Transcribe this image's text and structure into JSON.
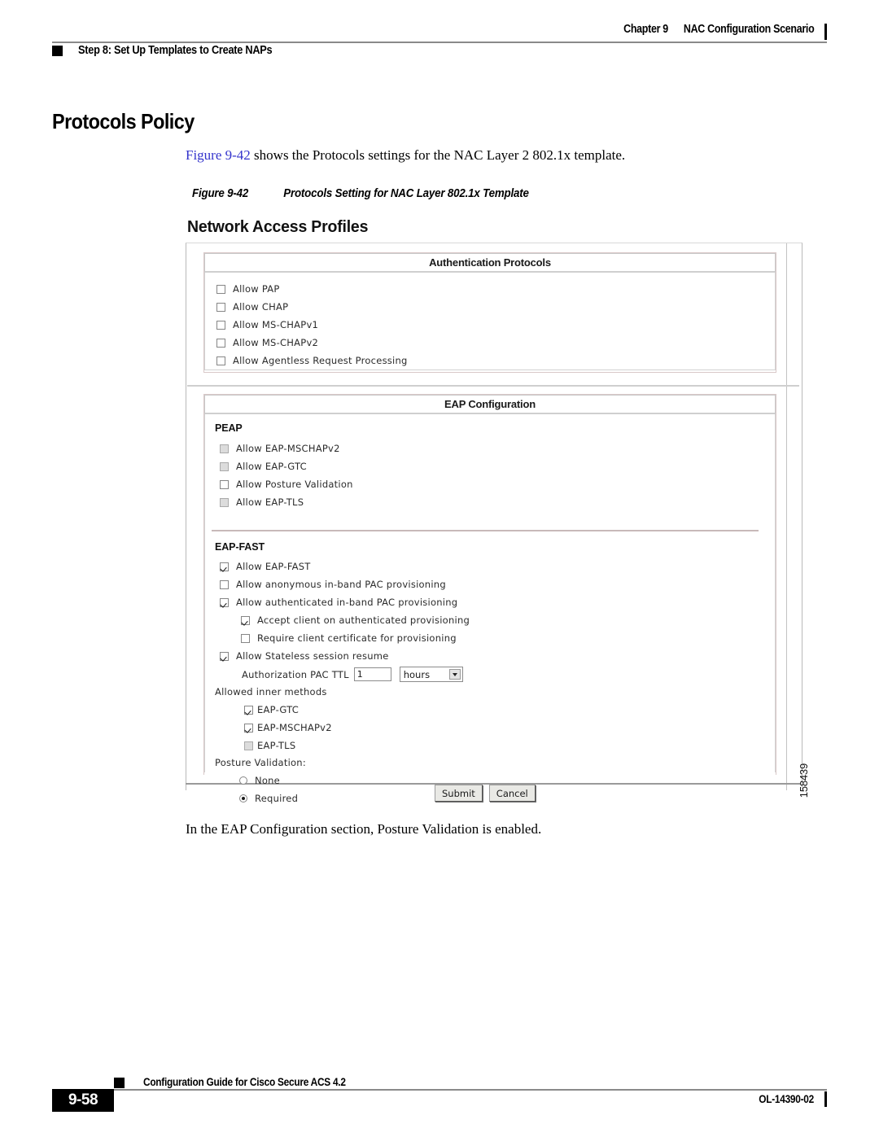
{
  "header": {
    "chapter_number": "Chapter 9",
    "chapter_title": "NAC Configuration Scenario",
    "step_title": "Step 8: Set Up Templates to Create NAPs"
  },
  "page": {
    "section_title": "Protocols Policy",
    "intro_xref": "Figure 9-42",
    "intro_rest": " shows the Protocols settings for the NAC Layer 2 802.1x template.",
    "figure_label": "Figure 9-42",
    "figure_title": "Protocols Setting for NAC Layer 802.1x Template",
    "closing_text": "In the EAP Configuration section, Posture Validation is enabled.",
    "figure_id": "158439"
  },
  "app": {
    "title": "Network Access Profiles",
    "auth_panel": {
      "heading": "Authentication Protocols",
      "items": [
        {
          "label": "Allow PAP",
          "checked": false,
          "disabled": false
        },
        {
          "label": "Allow CHAP",
          "checked": false,
          "disabled": false
        },
        {
          "label": "Allow MS-CHAPv1",
          "checked": false,
          "disabled": false
        },
        {
          "label": "Allow MS-CHAPv2",
          "checked": false,
          "disabled": false
        },
        {
          "label": "Allow Agentless Request Processing",
          "checked": false,
          "disabled": false
        }
      ]
    },
    "eap_panel": {
      "heading": "EAP Configuration",
      "peap": {
        "heading": "PEAP",
        "items": [
          {
            "label": "Allow EAP-MSCHAPv2",
            "checked": false,
            "disabled": true
          },
          {
            "label": "Allow EAP-GTC",
            "checked": false,
            "disabled": true
          },
          {
            "label": "Allow Posture Validation",
            "checked": false,
            "disabled": false
          },
          {
            "label": "Allow EAP-TLS",
            "checked": false,
            "disabled": true
          }
        ]
      },
      "eap_fast": {
        "heading": "EAP-FAST",
        "items": [
          {
            "label": "Allow EAP-FAST",
            "checked": true,
            "disabled": false
          },
          {
            "label": "Allow anonymous in-band PAC provisioning",
            "checked": false,
            "disabled": false
          },
          {
            "label": "Allow authenticated in-band PAC provisioning",
            "checked": true,
            "disabled": false
          },
          {
            "label": "Accept client on authenticated provisioning",
            "checked": true,
            "disabled": false
          },
          {
            "label": "Require client certificate for provisioning",
            "checked": false,
            "disabled": false
          },
          {
            "label": "Allow Stateless session resume",
            "checked": true,
            "disabled": false
          }
        ],
        "ttl_label": "Authorization PAC TTL",
        "ttl_value": "1",
        "ttl_unit": "hours",
        "inner_methods_label": "Allowed inner methods",
        "inner_methods": [
          {
            "label": "EAP-GTC",
            "checked": true,
            "disabled": false
          },
          {
            "label": "EAP-MSCHAPv2",
            "checked": true,
            "disabled": false
          },
          {
            "label": "EAP-TLS",
            "checked": false,
            "disabled": true
          }
        ],
        "posture_label": "Posture Validation:",
        "posture_options": [
          {
            "label": "None",
            "selected": false
          },
          {
            "label": "Required",
            "selected": true
          }
        ]
      }
    },
    "buttons": {
      "submit": "Submit",
      "cancel": "Cancel"
    }
  },
  "footer": {
    "guide_title": "Configuration Guide for Cisco Secure ACS 4.2",
    "page_number": "9-58",
    "doc_number": "OL-14390-02"
  }
}
